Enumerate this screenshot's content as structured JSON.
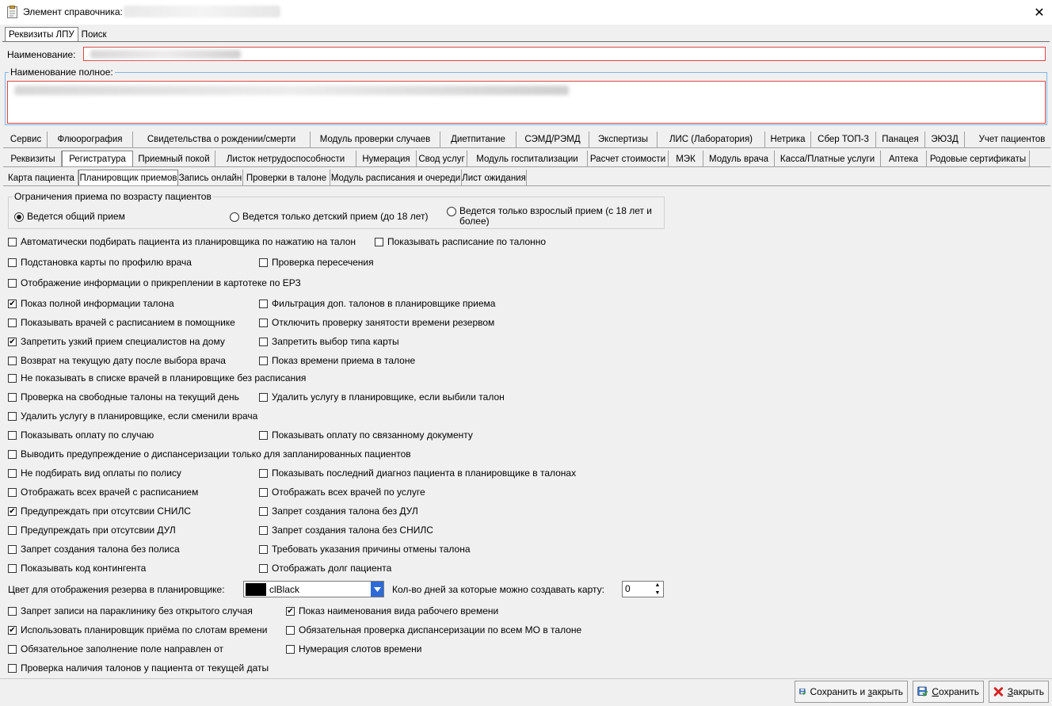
{
  "window": {
    "title": "Элемент справочника:",
    "close_glyph": "✕"
  },
  "tabs_main": [
    {
      "label": "Реквизиты ЛПУ",
      "active": true
    },
    {
      "label": "Поиск",
      "active": false
    }
  ],
  "fields": {
    "name_label": "Наименование:",
    "fullname_label": "Наименование полное:"
  },
  "tabs_modules": [
    "Сервис",
    "Флюорография",
    "Свидетельства о рождении/смерти",
    "Модуль проверки случаев",
    "Диетпитание",
    "СЭМД/РЭМД",
    "Экспертизы",
    "ЛИС (Лаборатория)",
    "Нетрика",
    "Сбер ТОП-3",
    "Панацея",
    "ЭЮЗД",
    "Учет пациентов"
  ],
  "tabs_sections": [
    "Реквизиты",
    "Регистратура",
    "Приемный покой",
    "Листок нетрудоспособности",
    "Нумерация",
    "Свод услуг",
    "Модуль госпитализации",
    "Расчет стоимости",
    "МЭК",
    "Модуль врача",
    "Касса/Платные услуги",
    "Аптека",
    "Родовые сертификаты"
  ],
  "tabs_registry": [
    "Карта пациента",
    "Планировщик приемов",
    "Запись онлайн",
    "Проверки в талоне",
    "Модуль расписания и очереди",
    "Лист ожидания"
  ],
  "age_group": {
    "legend": "Ограничения приема по возрасту пациентов",
    "options": [
      {
        "label": "Ведется общий прием",
        "checked": true
      },
      {
        "label": "Ведется только детский прием (до 18 лет)",
        "checked": false
      },
      {
        "label": "Ведется только взрослый прием (с 18 лет и более)",
        "checked": false
      }
    ]
  },
  "checkboxes": [
    {
      "label": "Автоматически подбирать пациента из планировщика по нажатию на талон",
      "checked": false
    },
    {
      "label": "Показывать расписание по талонно",
      "checked": false
    },
    {
      "label": "Подстановка карты по профилю врача",
      "checked": false
    },
    {
      "label": "Проверка пересечения",
      "checked": false
    },
    {
      "label": "Отображение информации о прикреплении в картотеке по ЕРЗ",
      "checked": false
    },
    {
      "label": "Показ полной информации талона",
      "checked": true
    },
    {
      "label": "Фильтрация доп. талонов в планировщике приема",
      "checked": false
    },
    {
      "label": "Показывать врачей с расписанием в помощнике",
      "checked": false
    },
    {
      "label": "Отключить проверку занятости времени резервом",
      "checked": false
    },
    {
      "label": "Запретить узкий прием специалистов на дому",
      "checked": true
    },
    {
      "label": "Запретить выбор типа карты",
      "checked": false
    },
    {
      "label": "Возврат на текущую дату после выбора врача",
      "checked": false
    },
    {
      "label": "Показ времени приема в талоне",
      "checked": false
    },
    {
      "label": "Не показывать в списке врачей в планировщике без расписания",
      "checked": false
    },
    {
      "label": "Проверка на свободные талоны на текущий день",
      "checked": false
    },
    {
      "label": "Удалить услугу в планировщике, если выбили талон",
      "checked": false
    },
    {
      "label": "Удалить услугу в планировщике, если сменили врача",
      "checked": false
    },
    {
      "label": "Показывать оплату по случаю",
      "checked": false
    },
    {
      "label": "Показывать оплату по связанному документу",
      "checked": false
    },
    {
      "label": "Выводить предупреждение о диспансеризации только для запланированных пациентов",
      "checked": false
    },
    {
      "label": "Не подбирать вид оплаты по полису",
      "checked": false
    },
    {
      "label": "Показывать последний диагноз пациента в планировщике в талонах",
      "checked": false
    },
    {
      "label": "Отображать всех врачей с расписанием",
      "checked": false
    },
    {
      "label": "Отображать всех врачей по услуге",
      "checked": false
    },
    {
      "label": "Предупреждать при отсутсвии СНИЛС",
      "checked": true
    },
    {
      "label": "Запрет создания талона без ДУЛ",
      "checked": false
    },
    {
      "label": "Предупреждать при отсутсвии ДУЛ",
      "checked": false
    },
    {
      "label": "Запрет создания талона без СНИЛС",
      "checked": false
    },
    {
      "label": "Запрет создания талона без полиса",
      "checked": false
    },
    {
      "label": "Требовать указания причины отмены талона",
      "checked": false
    },
    {
      "label": "Показывать код контингента",
      "checked": false
    },
    {
      "label": "Отображать долг пациента",
      "checked": false
    },
    {
      "label": "Запрет записи на параклинику без открытого случая",
      "checked": false
    },
    {
      "label": "Показ наименования вида рабочего времени",
      "checked": true
    },
    {
      "label": "Использовать планировщик приёма по слотам времени",
      "checked": true
    },
    {
      "label": "Обязательная проверка диспансеризации по всем МО в талоне",
      "checked": false
    },
    {
      "label": "Обязательное заполнение поле направлен от",
      "checked": false
    },
    {
      "label": "Нумерация слотов времени",
      "checked": false
    },
    {
      "label": "Проверка наличия талонов у пациента от текущей даты",
      "checked": false
    }
  ],
  "reserve_color": {
    "label": "Цвет для отображения резерва в планировщике:",
    "value": "clBlack",
    "swatch": "#000000"
  },
  "days": {
    "label": "Кол-во дней за которые можно создавать карту:",
    "value": "0"
  },
  "buttons": {
    "save_close_pre": "Сохранить и ",
    "save_close_u": "з",
    "save_close_post": "акрыть",
    "save_pre": "",
    "save_u": "С",
    "save_post": "охранить",
    "close_pre": "",
    "close_u": "З",
    "close_post": "акрыть"
  }
}
